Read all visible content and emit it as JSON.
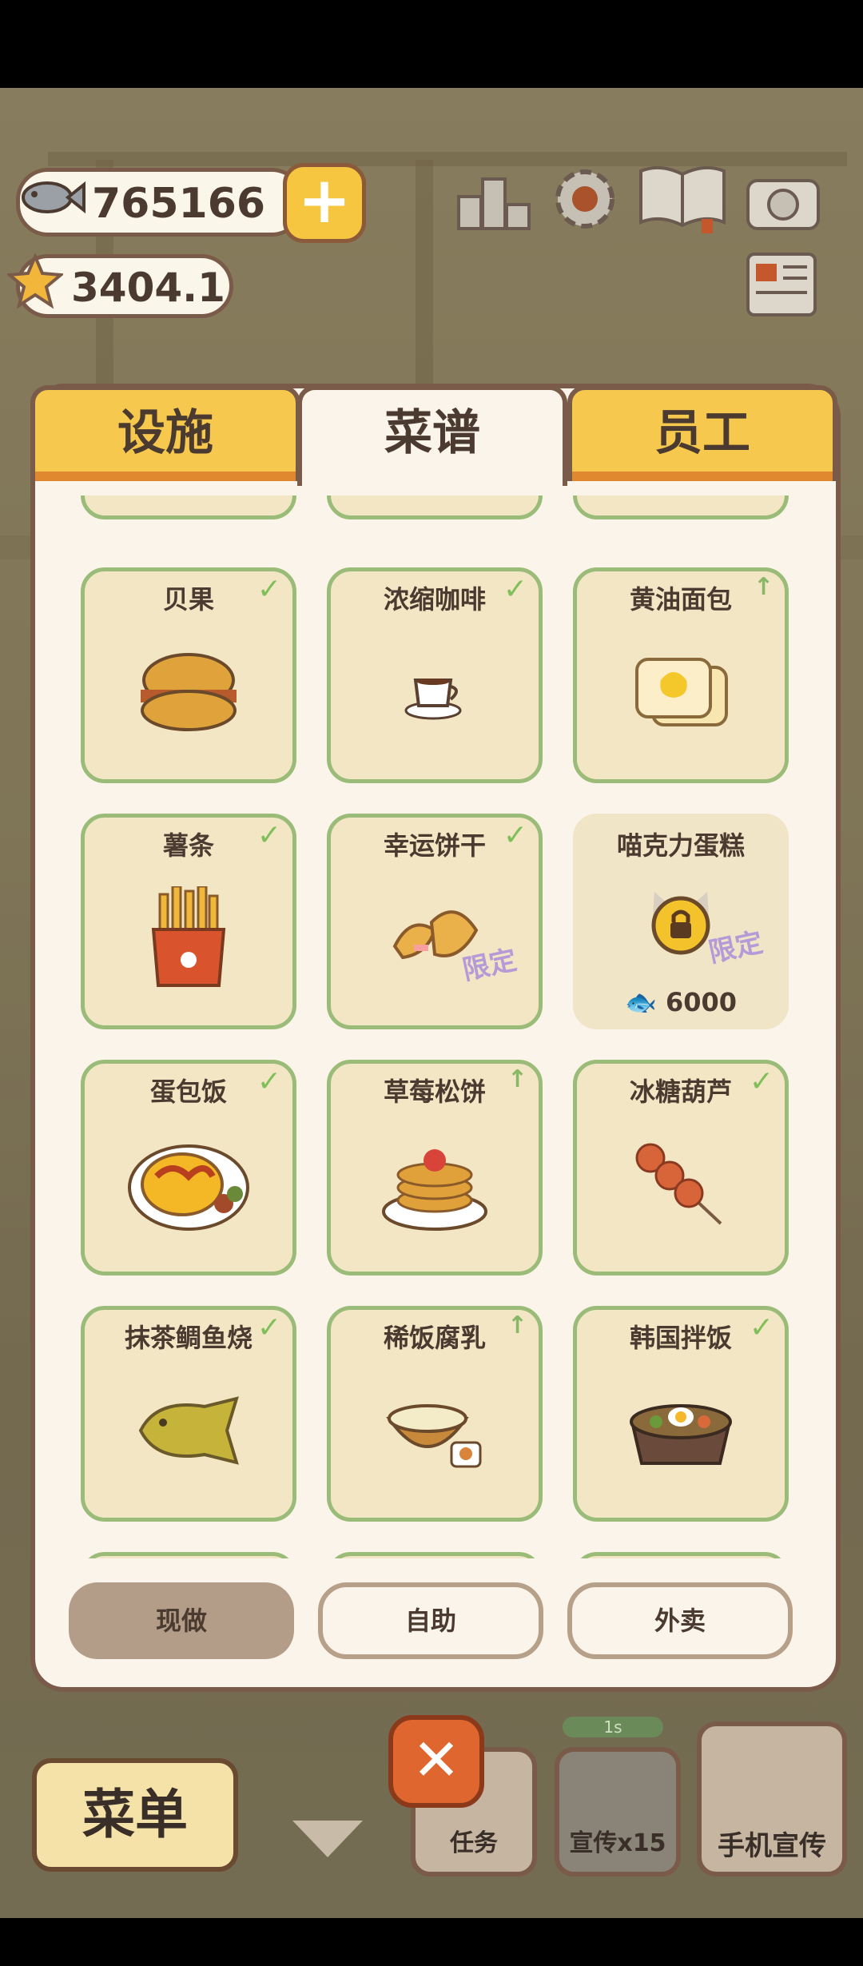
{
  "currency": {
    "fish": "765166",
    "stars": "3404.1",
    "plus": "+"
  },
  "top_icons": [
    "ranking-icon",
    "gear-icon",
    "guide-book-icon",
    "camera-icon",
    "newspaper-icon"
  ],
  "tabs": [
    {
      "label": "设施",
      "active": false
    },
    {
      "label": "菜谱",
      "active": true
    },
    {
      "label": "员工",
      "active": false
    }
  ],
  "recipes": [
    {
      "name": "贝果",
      "status": "done"
    },
    {
      "name": "浓缩咖啡",
      "status": "done"
    },
    {
      "name": "黄油面包",
      "status": "upgrade"
    },
    {
      "name": "薯条",
      "status": "done"
    },
    {
      "name": "幸运饼干",
      "status": "done",
      "tag": "限定"
    },
    {
      "name": "喵克力蛋糕",
      "status": "locked",
      "tag": "限定",
      "price": "6000"
    },
    {
      "name": "蛋包饭",
      "status": "done"
    },
    {
      "name": "草莓松饼",
      "status": "upgrade"
    },
    {
      "name": "冰糖葫芦",
      "status": "done"
    },
    {
      "name": "抹茶鲷鱼烧",
      "status": "done"
    },
    {
      "name": "稀饭腐乳",
      "status": "upgrade"
    },
    {
      "name": "韩国拌饭",
      "status": "done"
    }
  ],
  "badges": {
    "done": "✓",
    "upgrade": "↑"
  },
  "modes": [
    {
      "label": "现做",
      "selected": true
    },
    {
      "label": "自助",
      "selected": false
    },
    {
      "label": "外卖",
      "selected": false
    }
  ],
  "bottom_bar": {
    "menu": "菜单",
    "task": "任务",
    "promo": "宣传x15",
    "promo_timer": "1s",
    "phone_promo": "手机宣传",
    "close": "✕"
  },
  "colors": {
    "tab_yellow": "#f6c84d",
    "card_border": "#9bbc78",
    "check": "#7fbf5a",
    "limited": "#b49bd8"
  }
}
